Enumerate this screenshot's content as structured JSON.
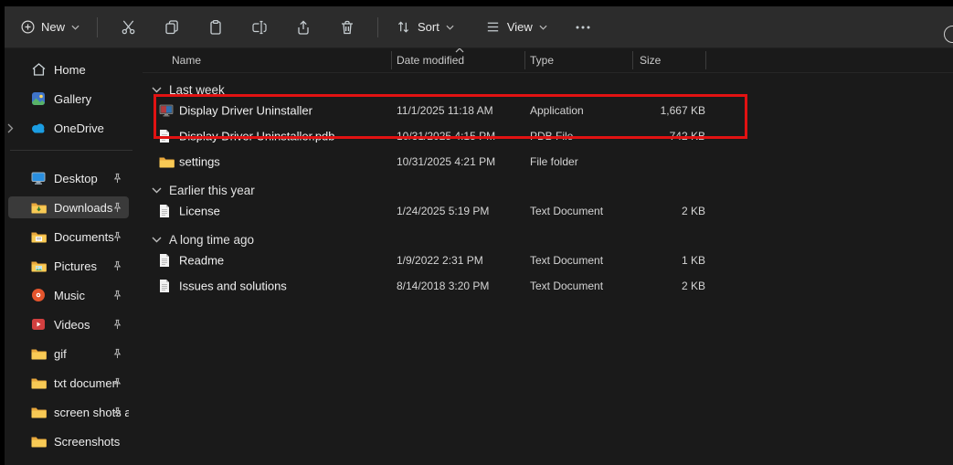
{
  "window": {
    "bg": "#1a1a1a",
    "toolbar_bg": "#2c2c2c",
    "selection_color": "#3a3a3a"
  },
  "toolbar": {
    "new_label": "New",
    "sort_label": "Sort",
    "view_label": "View",
    "icon_buttons": [
      "cut-icon",
      "copy-icon",
      "paste-icon",
      "rename-icon",
      "share-icon",
      "delete-icon"
    ],
    "more": "more-options"
  },
  "columns": [
    {
      "label": "Name"
    },
    {
      "label": "Date modified",
      "sorted": "ascending"
    },
    {
      "label": "Type"
    },
    {
      "label": "Size"
    }
  ],
  "sidebar": {
    "items": [
      {
        "label": "Home",
        "icon": "home-icon",
        "pinned": false
      },
      {
        "label": "Gallery",
        "icon": "gallery-icon",
        "pinned": false
      },
      {
        "label": "OneDrive",
        "icon": "onedrive-icon",
        "pinned": false,
        "expandable": true
      },
      {
        "label": "Desktop",
        "icon": "desktop-icon",
        "pinned": true
      },
      {
        "label": "Downloads",
        "icon": "downloads-icon",
        "pinned": true,
        "selected": true
      },
      {
        "label": "Documents",
        "icon": "documents-icon",
        "pinned": true
      },
      {
        "label": "Pictures",
        "icon": "pictures-icon",
        "pinned": true
      },
      {
        "label": "Music",
        "icon": "music-icon",
        "pinned": true
      },
      {
        "label": "Videos",
        "icon": "videos-icon",
        "pinned": true
      },
      {
        "label": "gif",
        "icon": "folder-icon",
        "pinned": true
      },
      {
        "label": "txt documen",
        "icon": "folder-icon",
        "pinned": true
      },
      {
        "label": "screen shots and",
        "icon": "folder-icon",
        "pinned": true
      },
      {
        "label": "Screenshots",
        "icon": "folder-icon",
        "pinned": false
      }
    ]
  },
  "groups": [
    {
      "label": "Last week",
      "files": [
        {
          "name": "Display Driver Uninstaller",
          "date": "11/1/2025 11:18 AM",
          "type": "Application",
          "size": "1,667 KB",
          "icon": "application-icon",
          "annotated": true
        },
        {
          "name": "Display Driver Uninstaller.pdb",
          "date": "10/31/2025 4:15 PM",
          "type": "PDB File",
          "size": "742 KB",
          "icon": "document-icon"
        },
        {
          "name": "settings",
          "date": "10/31/2025 4:21 PM",
          "type": "File folder",
          "size": "",
          "icon": "folder-icon"
        }
      ]
    },
    {
      "label": "Earlier this year",
      "files": [
        {
          "name": "License",
          "date": "1/24/2025 5:19 PM",
          "type": "Text Document",
          "size": "2 KB",
          "icon": "document-icon"
        }
      ]
    },
    {
      "label": "A long time ago",
      "files": [
        {
          "name": "Readme",
          "date": "1/9/2022 2:31 PM",
          "type": "Text Document",
          "size": "1 KB",
          "icon": "document-icon"
        },
        {
          "name": "Issues and solutions",
          "date": "8/14/2018 3:20 PM",
          "type": "Text Document",
          "size": "2 KB",
          "icon": "document-icon"
        }
      ]
    }
  ],
  "annotation": {
    "shape": "red-rectangle",
    "color": "#e11212",
    "target": "Display Driver Uninstaller"
  }
}
